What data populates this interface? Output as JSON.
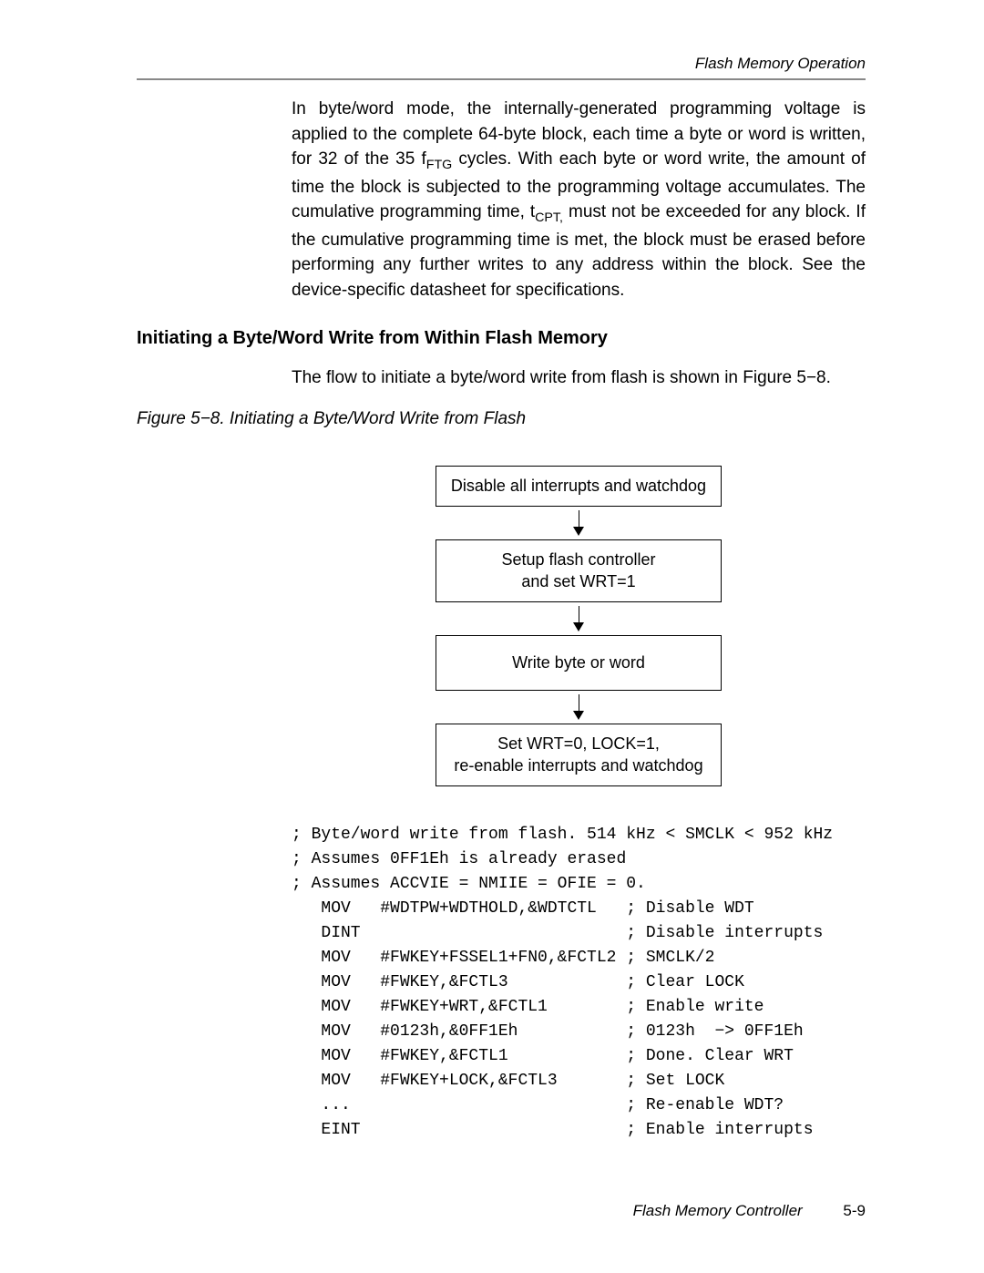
{
  "header": {
    "running": "Flash Memory Operation"
  },
  "p1_a": "In byte/word mode, the internally-generated programming voltage is applied to the complete 64-byte block, each time a byte or word is written, for 32 of the 35 f",
  "p1_sub1": "FTG",
  "p1_b": " cycles. With each byte or word write, the amount of time the block is subjected to the programming voltage accumulates. The cumulative programming time, t",
  "p1_sub2": "CPT,",
  "p1_c": " must not be exceeded for any block. If the cumulative programming time is met, the block must be erased before performing any further writes to any address within the block. See the device-specific datasheet for specifications.",
  "section": "Initiating a Byte/Word Write from Within Flash Memory",
  "p2": "The flow to initiate a byte/word write from flash is shown in Figure 5−8.",
  "figcap": "Figure 5−8. Initiating a Byte/Word Write from Flash",
  "flow": {
    "b1": "Disable all interrupts and watchdog",
    "b2a": "Setup flash controller",
    "b2b": "and set WRT=1",
    "b3": "Write byte or word",
    "b4a": "Set WRT=0, LOCK=1,",
    "b4b": "re-enable interrupts and watchdog"
  },
  "code": "; Byte/word write from flash. 514 kHz < SMCLK < 952 kHz\n; Assumes 0FF1Eh is already erased\n; Assumes ACCVIE = NMIIE = OFIE = 0.\n   MOV   #WDTPW+WDTHOLD,&WDTCTL   ; Disable WDT\n   DINT                           ; Disable interrupts\n   MOV   #FWKEY+FSSEL1+FN0,&FCTL2 ; SMCLK/2\n   MOV   #FWKEY,&FCTL3            ; Clear LOCK\n   MOV   #FWKEY+WRT,&FCTL1        ; Enable write\n   MOV   #0123h,&0FF1Eh           ; 0123h  −> 0FF1Eh\n   MOV   #FWKEY,&FCTL1            ; Done. Clear WRT\n   MOV   #FWKEY+LOCK,&FCTL3       ; Set LOCK\n   ...                            ; Re-enable WDT?\n   EINT                           ; Enable interrupts",
  "footer": {
    "title": "Flash Memory Controller",
    "page": "5-9"
  }
}
